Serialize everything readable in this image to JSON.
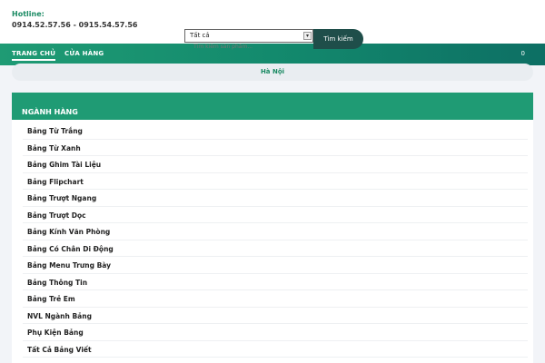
{
  "hotline": {
    "label": "Hotline:",
    "phones": "0914.52.57.56 - 0915.54.57.56"
  },
  "search": {
    "category_selected": "Tất cả",
    "placeholder": "Tìm kiếm sản phẩm...",
    "button_label": "Tìm kiếm",
    "arrow_icon": "chevron-down-icon"
  },
  "nav": {
    "items": [
      {
        "label": "TRANG CHỦ",
        "active": true
      },
      {
        "label": "CỬA HÀNG",
        "active": false
      }
    ],
    "cart_count": "0"
  },
  "location": "Hà Nội",
  "categories": {
    "title": "NGÀNH HÀNG",
    "items": [
      "Bảng Từ Trắng",
      "Bảng Từ Xanh",
      "Bảng Ghim Tài Liệu",
      "Bảng Flipchart",
      "Bảng Trượt Ngang",
      "Bảng Trượt Dọc",
      "Bảng Kính Văn Phòng",
      "Bảng Có Chân Di Động",
      "Bảng Menu Trưng Bày",
      "Bảng Thông Tin",
      "Bảng Trẻ Em",
      "NVL Ngành Bảng",
      "Phụ Kiện Bảng",
      "Tất Cả Bảng Viết"
    ]
  },
  "colors": {
    "brand_green": "#1f9b74",
    "brand_dark": "#1f4e4a",
    "accent_text": "#1a8a63"
  }
}
